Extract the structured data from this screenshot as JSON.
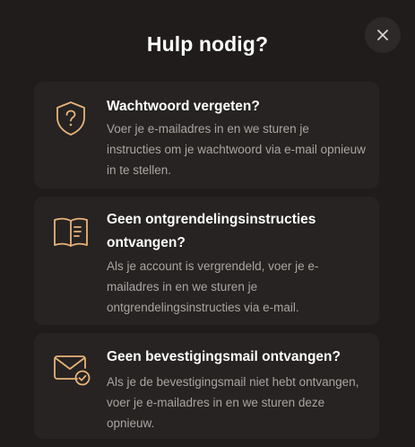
{
  "dialog": {
    "title": "Hulp nodig?",
    "close_icon": "close-icon"
  },
  "cards": [
    {
      "icon": "shield-question-icon",
      "title": "Wachtwoord vergeten?",
      "description": "Voer je e-mailadres in en we sturen je instructies om je wachtwoord via e-mail opnieuw in te stellen."
    },
    {
      "icon": "book-icon",
      "title": "Geen ontgrendelingsinstructies ontvangen?",
      "description": "Als je account is vergrendeld, voer je e-mailadres in en we sturen je ontgrendelingsinstructies via e-mail."
    },
    {
      "icon": "envelope-check-icon",
      "title": "Geen bevestigingsmail ontvangen?",
      "description": "Als je de bevestigingsmail niet hebt ontvangen, voer je e-mailadres in en we sturen deze opnieuw."
    }
  ],
  "colors": {
    "background": "#1f1c1b",
    "card": "#262322",
    "accent": "#e8b27a",
    "title": "#ffffff",
    "text_muted": "#a9a5a2"
  }
}
